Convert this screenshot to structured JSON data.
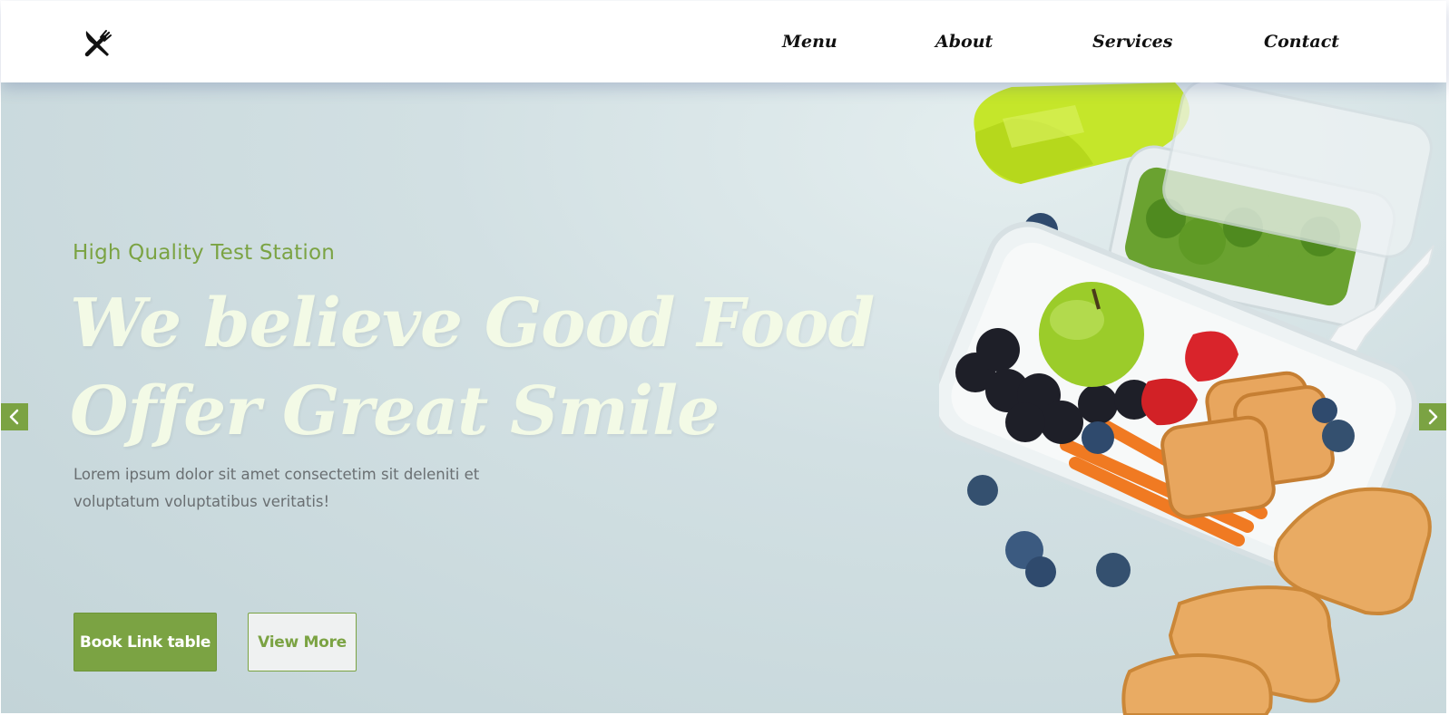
{
  "header": {
    "logo_icon": "fork-knife-icon",
    "nav": [
      {
        "label": "Menu"
      },
      {
        "label": "About"
      },
      {
        "label": "Services"
      },
      {
        "label": "Contact"
      }
    ]
  },
  "hero": {
    "subtitle": "High Quality Test Station",
    "headline_line1": "We believe Good Food",
    "headline_line2": "Offer Great Smile",
    "description": "Lorem ipsum dolor sit amet consectetim sit deleniti et voluptatum voluptatibus veritatis!",
    "primary_button": "Book Link table",
    "secondary_button": "View More",
    "image_icon": "lunchbox-food-illustration"
  },
  "carousel": {
    "prev_icon": "chevron-left-icon",
    "next_icon": "chevron-right-icon"
  },
  "colors": {
    "accent": "#7ba343",
    "headline": "#f3fae6",
    "background": "#d2e0e3"
  }
}
